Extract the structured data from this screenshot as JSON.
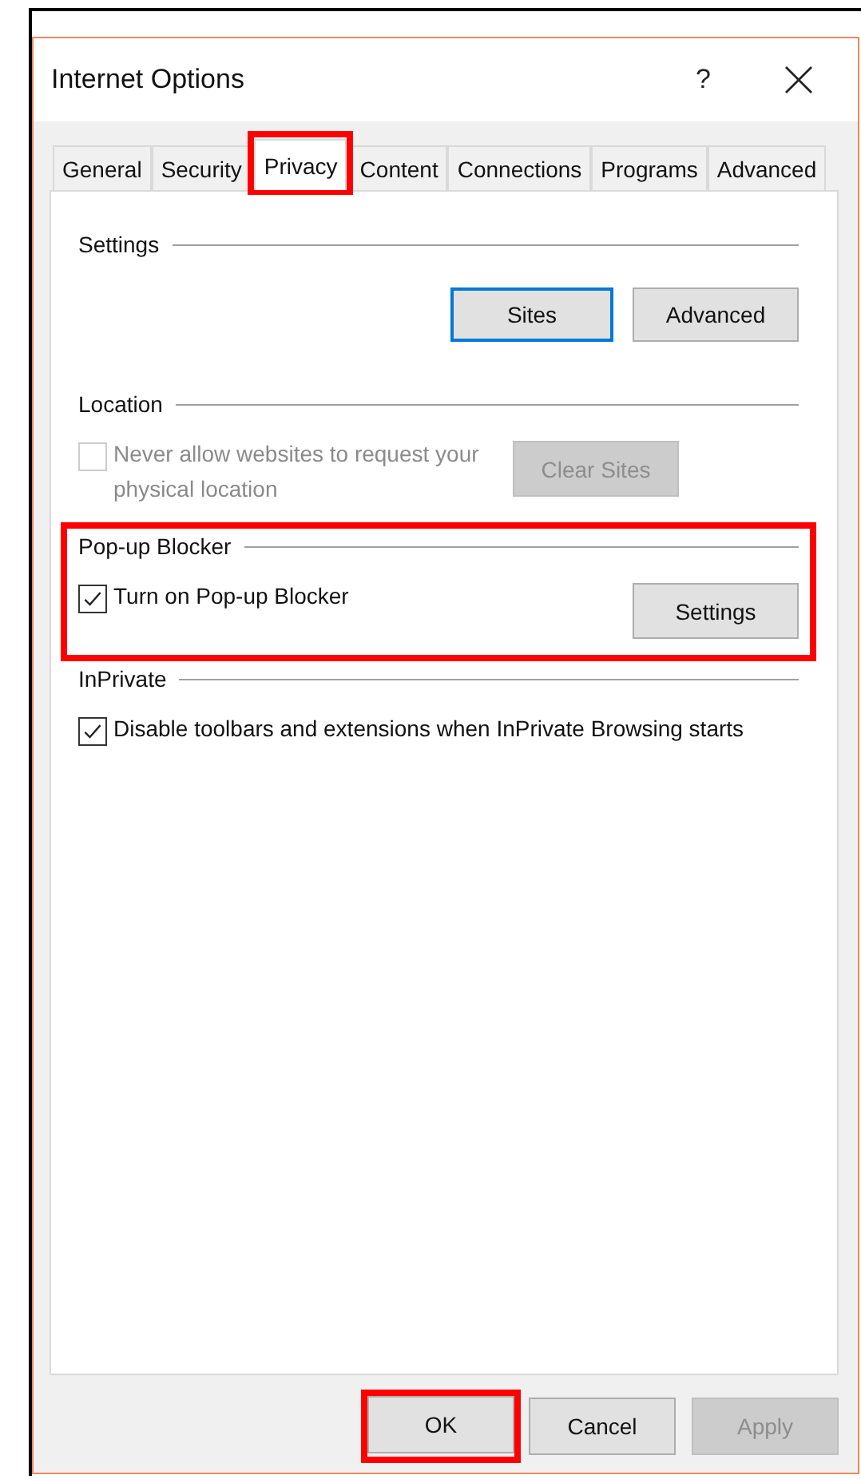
{
  "window": {
    "title": "Internet Options",
    "help": "?"
  },
  "tabs": [
    {
      "label": "General",
      "selected": false,
      "highlighted": false
    },
    {
      "label": "Security",
      "selected": false,
      "highlighted": false
    },
    {
      "label": "Privacy",
      "selected": true,
      "highlighted": true
    },
    {
      "label": "Content",
      "selected": false,
      "highlighted": false
    },
    {
      "label": "Connections",
      "selected": false,
      "highlighted": false
    },
    {
      "label": "Programs",
      "selected": false,
      "highlighted": false
    },
    {
      "label": "Advanced",
      "selected": false,
      "highlighted": false
    }
  ],
  "sections": [
    {
      "title": "Settings",
      "highlighted": false,
      "items": [
        {
          "kind": "buttons",
          "buttons": [
            {
              "label": "Sites",
              "focused": true,
              "disabled": false
            },
            {
              "label": "Advanced",
              "focused": false,
              "disabled": false
            }
          ]
        }
      ]
    },
    {
      "title": "Location",
      "highlighted": false,
      "items": [
        {
          "kind": "checkbox",
          "label": "Never allow websites to request your physical location",
          "checked": false,
          "disabled": true,
          "button": {
            "label": "Clear Sites",
            "focused": false,
            "disabled": true
          }
        }
      ]
    },
    {
      "title": "Pop-up Blocker",
      "highlighted": true,
      "items": [
        {
          "kind": "checkbox",
          "label": "Turn on Pop-up Blocker",
          "checked": true,
          "disabled": false,
          "button": {
            "label": "Settings",
            "focused": false,
            "disabled": false
          }
        }
      ]
    },
    {
      "title": "InPrivate",
      "highlighted": false,
      "items": [
        {
          "kind": "checkbox",
          "label": "Disable toolbars and extensions when InPrivate Browsing starts",
          "checked": true,
          "disabled": false
        }
      ]
    }
  ],
  "footer": [
    {
      "label": "OK",
      "disabled": false,
      "highlighted": true
    },
    {
      "label": "Cancel",
      "disabled": false,
      "highlighted": false
    },
    {
      "label": "Apply",
      "disabled": true,
      "highlighted": false
    }
  ]
}
